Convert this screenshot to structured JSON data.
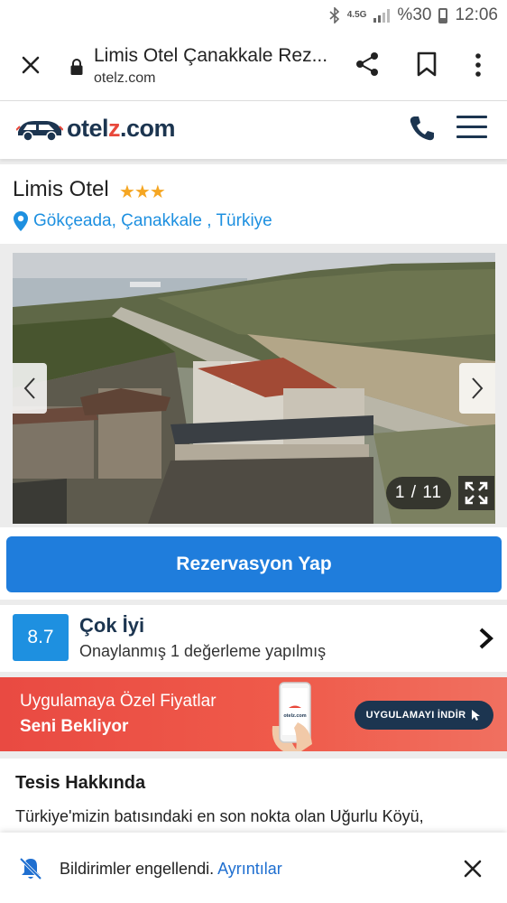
{
  "status_bar": {
    "network": "4.5G",
    "battery": "%30",
    "time": "12:06"
  },
  "browser": {
    "page_title": "Limis Otel Çanakkale Rez...",
    "domain": "otelz.com"
  },
  "site": {
    "logo_prefix": "otel",
    "logo_z": "z",
    "logo_suffix": ".com"
  },
  "hotel": {
    "name": "Limis Otel",
    "stars": "★★★",
    "location": "Gökçeada, Çanakkale , Türkiye"
  },
  "gallery": {
    "counter": "1 / 11",
    "current": 1,
    "total": 11
  },
  "cta": {
    "label": "Rezervasyon Yap"
  },
  "rating": {
    "score": "8.7",
    "label": "Çok İyi",
    "subtitle": "Onaylanmış 1 değerleme yapılmış"
  },
  "promo": {
    "line1": "Uygulamaya Özel Fiyatlar",
    "line2": "Seni Bekliyor",
    "phone_brand": "otelz.com",
    "button": "UYGULAMAYI İNDİR"
  },
  "about": {
    "title": "Tesis Hakkında",
    "text": "Türkiye'mizin batısındaki en son nokta olan Uğurlu Köyü,"
  },
  "notification": {
    "text": "Bildirimler engellendi.",
    "link": "Ayrıntılar"
  },
  "colors": {
    "accent": "#1f7ddc",
    "brand_navy": "#1c3550",
    "brand_red": "#e8483b",
    "location_blue": "#1e90e0",
    "star": "#f5a623"
  },
  "icons": [
    "bluetooth-icon",
    "signal-icon",
    "battery-icon",
    "close-icon",
    "lock-icon",
    "share-icon",
    "bookmark-icon",
    "more-vert-icon",
    "phone-icon",
    "menu-icon",
    "location-pin-icon",
    "chevron-left-icon",
    "chevron-right-icon",
    "fullscreen-icon",
    "bell-off-icon"
  ]
}
